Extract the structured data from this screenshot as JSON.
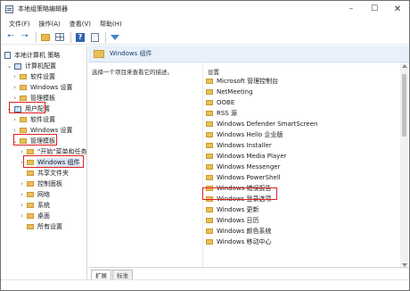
{
  "window": {
    "title": "本地组策略编辑器"
  },
  "menu": [
    "文件(F)",
    "操作(A)",
    "查看(V)",
    "帮助(H)"
  ],
  "tree": [
    {
      "label": "本地计算机 策略",
      "indent": 0,
      "icon": "policy-icon",
      "expander": ""
    },
    {
      "label": "计算机配置",
      "indent": 1,
      "icon": "computer-icon",
      "expander": "v"
    },
    {
      "label": "软件设置",
      "indent": 2,
      "icon": "folder-icon",
      "expander": ">"
    },
    {
      "label": "Windows 设置",
      "indent": 2,
      "icon": "folder-icon",
      "expander": ">"
    },
    {
      "label": "管理模板",
      "indent": 2,
      "icon": "folder-icon",
      "expander": ">"
    },
    {
      "label": "用户配置",
      "indent": 1,
      "icon": "computer-icon",
      "expander": "v"
    },
    {
      "label": "软件设置",
      "indent": 2,
      "icon": "folder-icon",
      "expander": ">"
    },
    {
      "label": "Windows 设置",
      "indent": 2,
      "icon": "folder-icon",
      "expander": ">"
    },
    {
      "label": "管理模板",
      "indent": 2,
      "icon": "folder-icon",
      "expander": "v"
    },
    {
      "label": "\"开始\"菜单和任务",
      "indent": 3,
      "icon": "folder-icon",
      "expander": ">"
    },
    {
      "label": "Windows 组件",
      "indent": 3,
      "icon": "folder-icon",
      "expander": ">",
      "selected": true
    },
    {
      "label": "共享文件夹",
      "indent": 3,
      "icon": "folder-icon",
      "expander": ""
    },
    {
      "label": "控制面板",
      "indent": 3,
      "icon": "folder-icon",
      "expander": ">"
    },
    {
      "label": "网络",
      "indent": 3,
      "icon": "folder-icon",
      "expander": ">"
    },
    {
      "label": "系统",
      "indent": 3,
      "icon": "folder-icon",
      "expander": ">"
    },
    {
      "label": "桌面",
      "indent": 3,
      "icon": "folder-icon",
      "expander": ">"
    },
    {
      "label": "所有设置",
      "indent": 3,
      "icon": "folder-icon",
      "expander": ""
    }
  ],
  "pane": {
    "title": "Windows 组件",
    "description": "选择一个项目来查看它的描述。",
    "column_header": "设置"
  },
  "items": [
    "Microsoft 管理控制台",
    "NetMeeting",
    "OOBE",
    "RSS 源",
    "Windows Defender SmartScreen",
    "Windows Hello 企业版",
    "Windows Installer",
    "Windows Media Player",
    "Windows Messenger",
    "Windows PowerShell",
    "Windows 错误报告",
    "Windows 登录选项",
    "Windows 更新",
    "Windows 日历",
    "Windows 颜色系统",
    "Windows 移动中心"
  ],
  "tabs": [
    "扩展",
    "标准"
  ],
  "colors": {
    "highlight": "#e01f1f",
    "header_bg": "#e8f0fa",
    "folder": "#e8c05a"
  }
}
